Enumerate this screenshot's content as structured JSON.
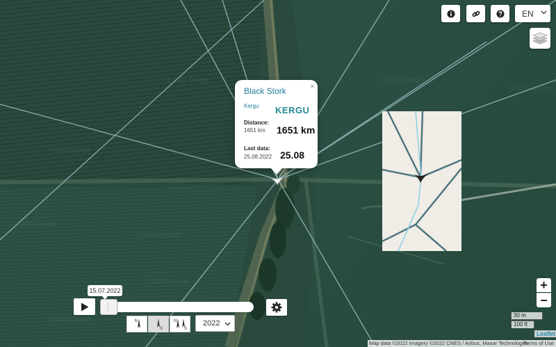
{
  "map": {
    "background": "satellite-imagery",
    "watermark": "© 2022 Google",
    "tracked_bird_icon": "bird-icon"
  },
  "toolbar": {
    "buttons": [
      {
        "name": "info-icon"
      },
      {
        "name": "link-icon"
      },
      {
        "name": "help-icon"
      }
    ],
    "language": "EN"
  },
  "layers": {
    "icon": "layers-icon"
  },
  "popup": {
    "title": "Black Stork",
    "subtitle": "Kergu",
    "name_big": "KERGU",
    "distance_label": "Distance:",
    "distance_small": "1651 km",
    "distance_big": "1651 km",
    "lastdata_label": "Last data:",
    "lastdata_small": "25.08.2022",
    "lastdata_big": "25.08",
    "close": "×"
  },
  "timeline": {
    "date": "15.07.2022",
    "position": 0.0
  },
  "orientation": {
    "north": "N",
    "south": "S"
  },
  "year": {
    "selected": "2022"
  },
  "zoom": {
    "in": "+",
    "out": "−"
  },
  "scale": {
    "metric": "30 m",
    "imperial": "100 ft"
  },
  "attribution": {
    "text": "Map data ©2022 Imagery ©2022 CNES / Airbus, Maxar Technologies",
    "terms": "Terms of Use",
    "leaflet": "Leaflet"
  },
  "colors": {
    "accent": "#1f7a9c",
    "popup_name": "#1f8a90",
    "track_line": "#a3c9cf",
    "inset_route": "#4f7680",
    "inset_route_light": "#8fd0e6",
    "inset_bg": "#f0ede6"
  }
}
